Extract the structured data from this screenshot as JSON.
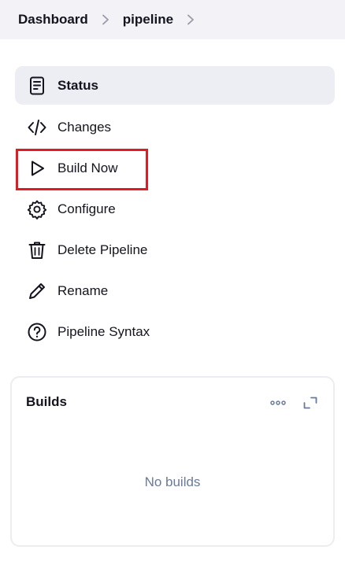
{
  "breadcrumb": {
    "items": [
      {
        "label": "Dashboard"
      },
      {
        "label": "pipeline"
      }
    ]
  },
  "side_nav": {
    "items": [
      {
        "label": "Status",
        "icon": "document-icon",
        "active": true
      },
      {
        "label": "Changes",
        "icon": "code-icon"
      },
      {
        "label": "Build Now",
        "icon": "play-icon"
      },
      {
        "label": "Configure",
        "icon": "gear-icon"
      },
      {
        "label": "Delete Pipeline",
        "icon": "trash-icon"
      },
      {
        "label": "Rename",
        "icon": "pencil-icon"
      },
      {
        "label": "Pipeline Syntax",
        "icon": "help-circle-icon"
      }
    ]
  },
  "builds": {
    "title": "Builds",
    "empty_text": "No builds"
  },
  "colors": {
    "breadcrumb_bg": "#f2f2f7",
    "active_item_bg": "#ededf4",
    "highlight": "#e01b24",
    "muted_text": "#6a7a9a"
  }
}
